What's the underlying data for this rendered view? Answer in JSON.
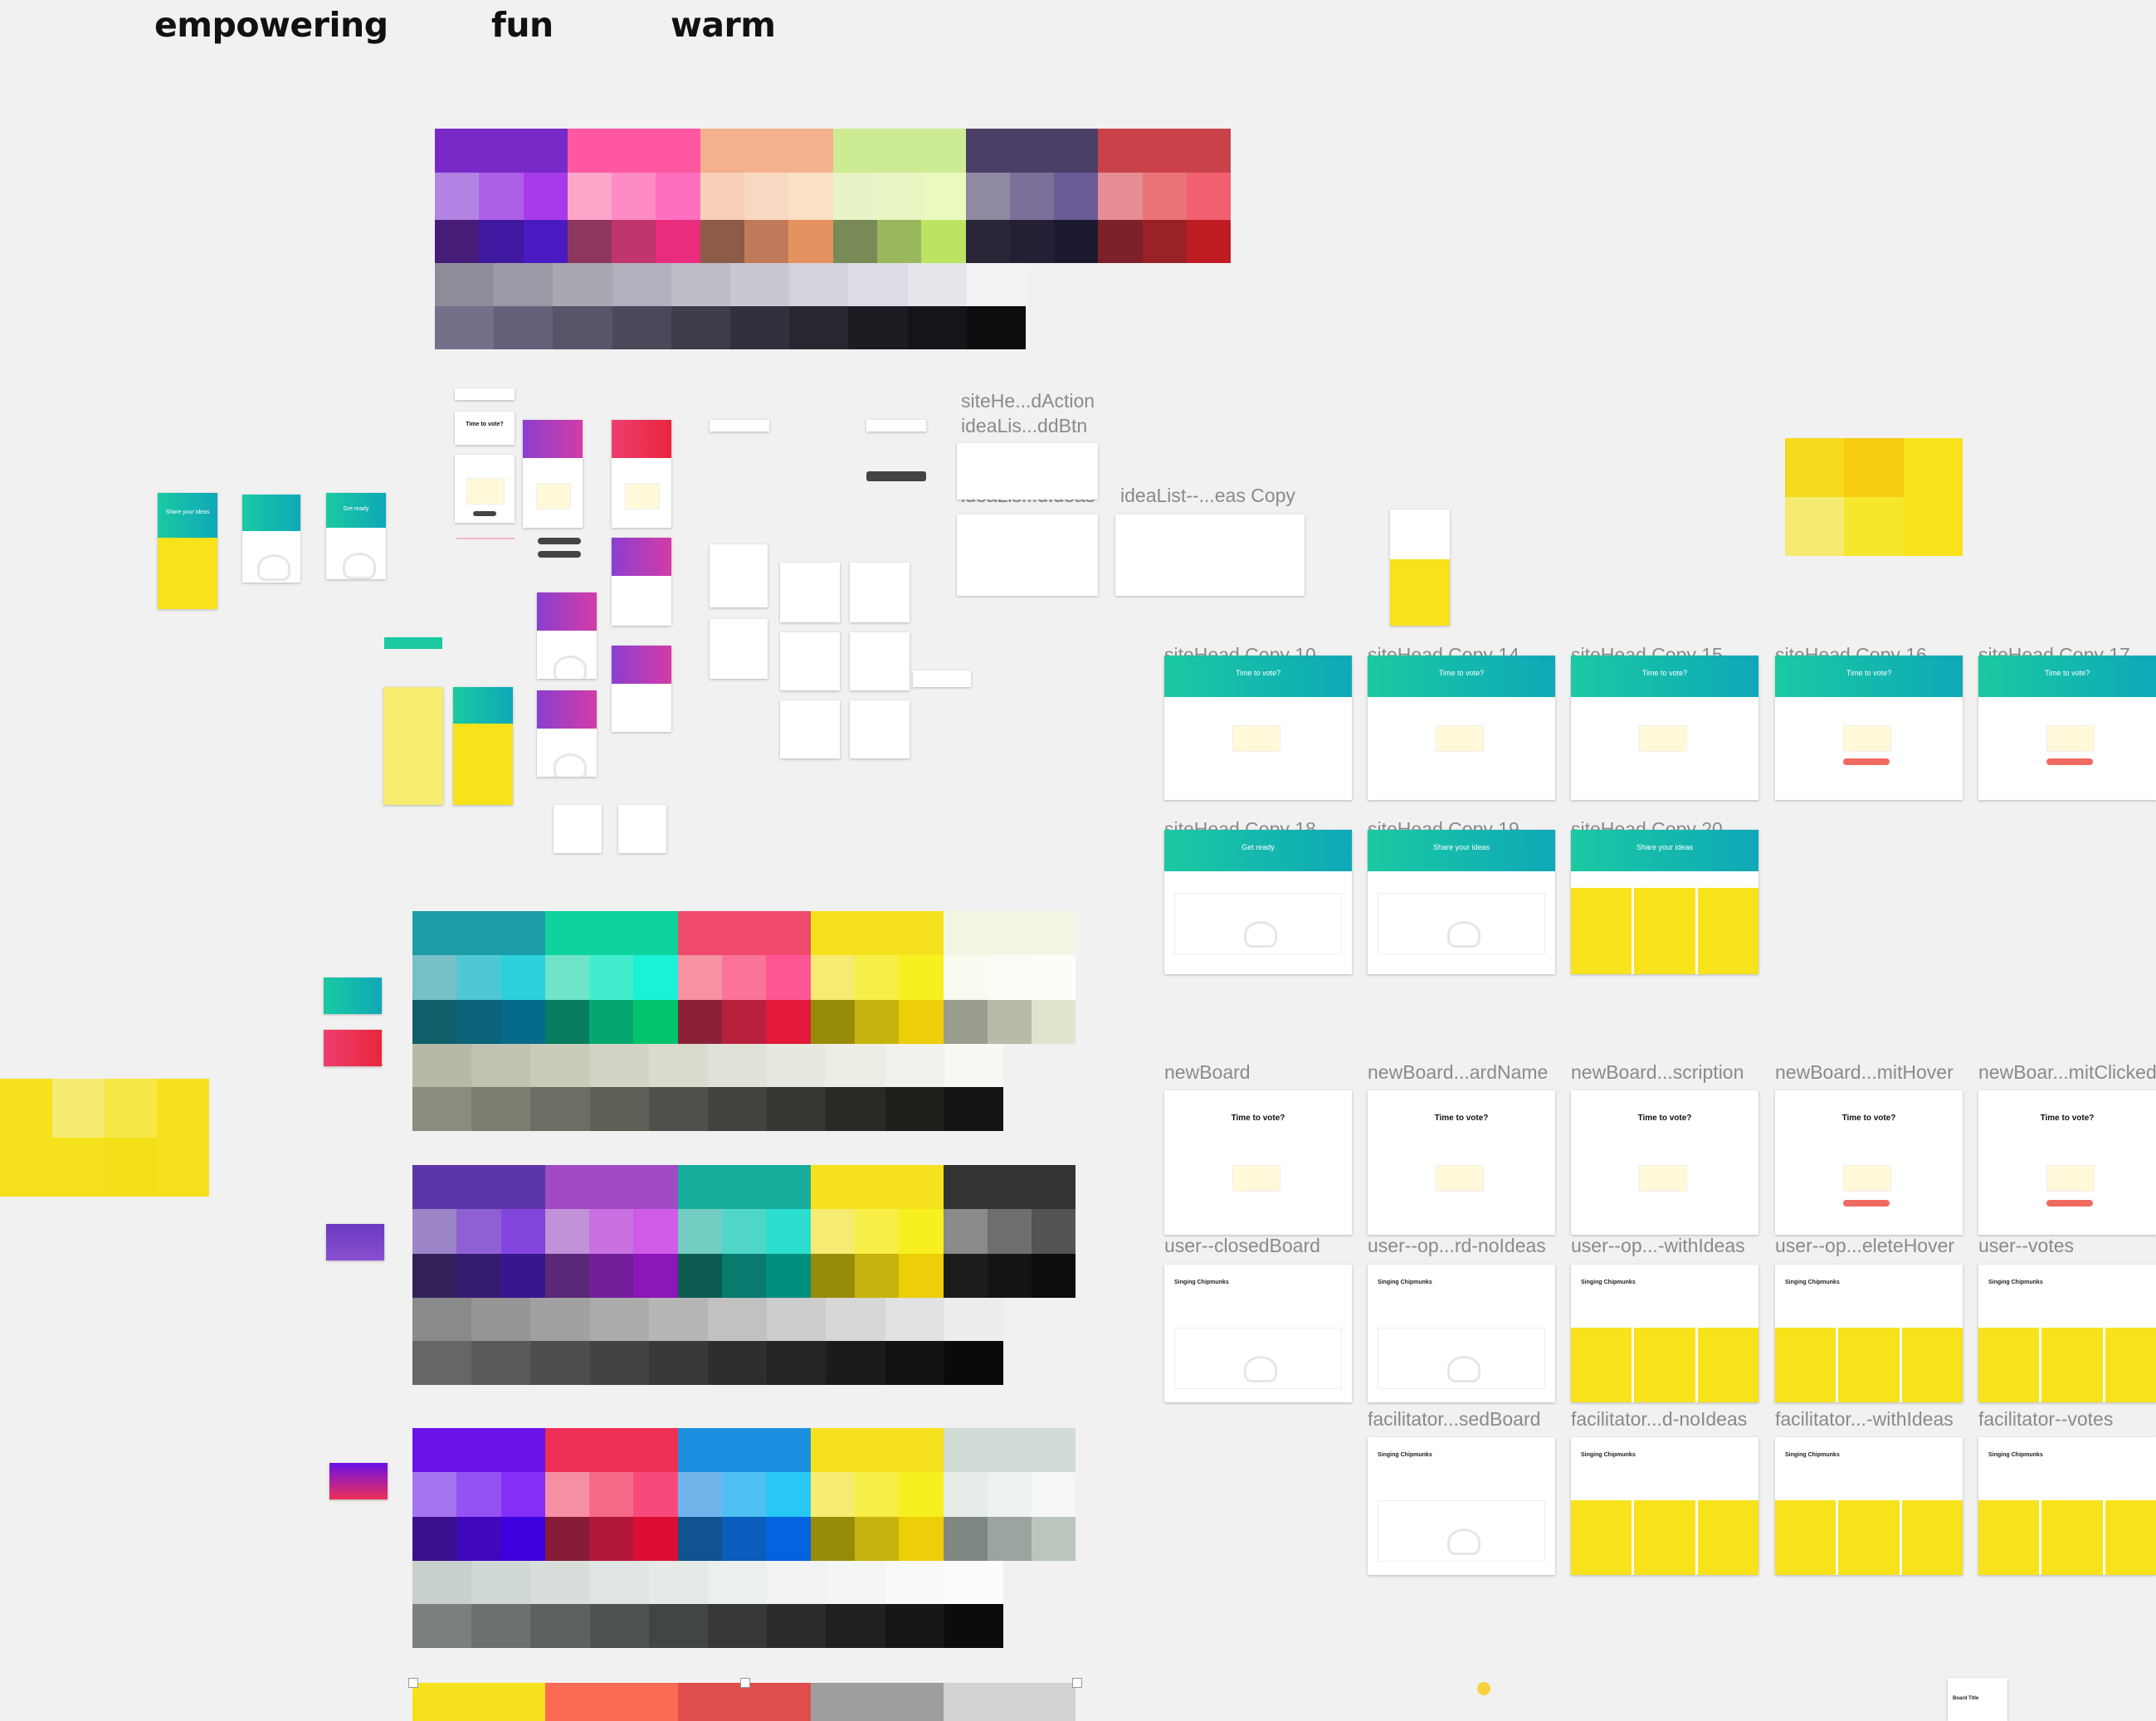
{
  "moods": [
    "empowering",
    "fun",
    "warm"
  ],
  "palettes": [
    {
      "name": "palette-primary",
      "rows": [
        [
          "#7a29c9",
          "#7a29c9",
          "#7a29c9",
          "#ff58a1",
          "#ff58a1",
          "#ff58a1",
          "#f5b08d",
          "#f5b08d",
          "#f5b08d",
          "#cdeb92",
          "#cdeb92",
          "#cdeb92",
          "#4b3f67",
          "#4b3f67",
          "#4b3f67",
          "#c9424a",
          "#c9424a",
          "#c9424a"
        ],
        [
          "#b383e3",
          "#ad5fe7",
          "#a83be9",
          "#fca7ca",
          "#fd8cc5",
          "#fd6fbe",
          "#f8cfb8",
          "#f9d8c3",
          "#fbdfc6",
          "#e8f4c7",
          "#e9f6c4",
          "#e9f9bf",
          "#8f8aa1",
          "#7c6f9a",
          "#6b5c97",
          "#e68c93",
          "#e97376",
          "#f06070"
        ],
        [
          "#451c77",
          "#3f18a1",
          "#4b19c1",
          "#8e375e",
          "#c0356c",
          "#ea2c7c",
          "#8c5c47",
          "#c07a59",
          "#e69260",
          "#788a55",
          "#9ab75e",
          "#bde362",
          "#2a2637",
          "#231f35",
          "#1c1a30",
          "#7c202a",
          "#982228",
          "#bd1c22"
        ],
        [
          "#8e8c99",
          "#9c9aa6",
          "#a9a7b2",
          "#b2b0bc",
          "#bebcc6",
          "#c9c7d1",
          "#d4d3dc",
          "#dddce4",
          "#e6e6ec",
          "#f2f2f4"
        ],
        [
          "#74708a",
          "#66617a",
          "#595469",
          "#4c4759",
          "#3f3b4a",
          "#33303d",
          "#28262f",
          "#1e1c23",
          "#151419",
          "#0d0c0f"
        ]
      ]
    },
    {
      "name": "palette-teal",
      "rows": [
        [
          "#1c9ba8",
          "#1c9ba8",
          "#1c9ba8",
          "#0fd39e",
          "#0fd39e",
          "#0fd39e",
          "#ef4a6c",
          "#ef4a6c",
          "#ef4a6c",
          "#f6e21c",
          "#f6e21c",
          "#f6e21c",
          "#f4f6e5",
          "#f4f6e5",
          "#f4f6e5"
        ],
        [
          "#76c0c8",
          "#4fc8d3",
          "#2bd0dc",
          "#6ee5c8",
          "#41edcd",
          "#1af1d5",
          "#f792a3",
          "#fa7398",
          "#fd5593",
          "#f6ec72",
          "#f7ee48",
          "#f8ef1f",
          "#f9faf0",
          "#fbfcf5",
          "#fcfdf8"
        ],
        [
          "#0f5f6b",
          "#0a6378",
          "#066b8b",
          "#087c5e",
          "#04a76f",
          "#02c46c",
          "#8a2139",
          "#b8203d",
          "#e3183a",
          "#978b0a",
          "#c6b30e",
          "#eccf08",
          "#9a9d8e",
          "#b8bba8",
          "#e1e4cd"
        ],
        [
          "#b7b8a7",
          "#c1c2b2",
          "#cacbbb",
          "#d2d3c4",
          "#dadbce",
          "#e1e2d7",
          "#e7e8df",
          "#edede6",
          "#f2f2ed",
          "#f7f7f3"
        ],
        [
          "#8b8c80",
          "#7c7d71",
          "#6d6e63",
          "#5e5f56",
          "#4f5049",
          "#42433d",
          "#353631",
          "#292a26",
          "#1e1e1b",
          "#131311"
        ]
      ]
    },
    {
      "name": "palette-purple",
      "rows": [
        [
          "#5c35a8",
          "#5c35a8",
          "#5c35a8",
          "#a04ac6",
          "#a04ac6",
          "#a04ac6",
          "#16ad9a",
          "#16ad9a",
          "#16ad9a",
          "#f6e21c",
          "#f6e21c",
          "#f6e21c",
          "#333333",
          "#333333",
          "#333333"
        ],
        [
          "#9d85c9",
          "#8f60d4",
          "#8145de",
          "#c292d8",
          "#c971e0",
          "#d05be6",
          "#73ccc1",
          "#50d6c8",
          "#2bded0",
          "#f6ec72",
          "#f7ee48",
          "#f8ef1f",
          "#8a8a8a",
          "#6f6f6f",
          "#545454"
        ],
        [
          "#33215a",
          "#351c73",
          "#38168d",
          "#5b2777",
          "#721e9a",
          "#8b17b8",
          "#0d5c52",
          "#087a6e",
          "#018f80",
          "#978b0a",
          "#c6b30e",
          "#eccf08",
          "#1c1c1c",
          "#141414",
          "#0d0d0d"
        ],
        [
          "#8a8a8a",
          "#959595",
          "#a0a0a0",
          "#ababab",
          "#b6b6b6",
          "#c1c1c1",
          "#cccccc",
          "#d7d7d7",
          "#e2e2e2",
          "#ededed"
        ],
        [
          "#666666",
          "#5a5a5a",
          "#4e4e4e",
          "#434343",
          "#383838",
          "#2e2e2e",
          "#242424",
          "#1b1b1b",
          "#121212",
          "#0a0a0a"
        ]
      ]
    },
    {
      "name": "palette-violet",
      "rows": [
        [
          "#6a12e8",
          "#6a12e8",
          "#6a12e8",
          "#ef2e55",
          "#ef2e55",
          "#ef2e55",
          "#1d8fe0",
          "#1d8fe0",
          "#1d8fe0",
          "#f6e21c",
          "#f6e21c",
          "#f6e21c",
          "#d2dcd6",
          "#d2dcd6",
          "#d2dcd6"
        ],
        [
          "#a574f0",
          "#9451f3",
          "#8530f7",
          "#f58fa3",
          "#f76989",
          "#f84a7a",
          "#72b5ec",
          "#4ec0f2",
          "#28c8f6",
          "#f6ec72",
          "#f7ee48",
          "#f8ef1f",
          "#e6ece8",
          "#eef2f0",
          "#f5f7f6"
        ],
        [
          "#3c0f8e",
          "#3f08ba",
          "#3f00e0",
          "#861c35",
          "#b1163b",
          "#dc0e34",
          "#0f5390",
          "#0a5dbc",
          "#0464e0",
          "#978b0a",
          "#c6b30e",
          "#eccf08",
          "#7f8782",
          "#9ca49f",
          "#bac5be"
        ],
        [
          "#c7d0cb",
          "#d0d8d3",
          "#d8dfdb",
          "#dfe5e2",
          "#e5eae7",
          "#ebefed",
          "#f0f3f1",
          "#f4f6f5",
          "#f8f9f8",
          "#fbfcfb"
        ],
        [
          "#7a807c",
          "#6b716d",
          "#5c625f",
          "#4e5350",
          "#414543",
          "#353836",
          "#2a2c2b",
          "#1f2120",
          "#151616",
          "#0b0c0b"
        ]
      ]
    },
    {
      "name": "palette-bottom",
      "rows": [
        [
          "#f6e21c",
          "#f6e21c",
          "#f6e21c",
          "#fd6a55",
          "#fd6a55",
          "#fd6a55",
          "#dd4e4c",
          "#dd4e4c",
          "#dd4e4c",
          "#9e9e9e",
          "#9e9e9e",
          "#9e9e9e",
          "#d2d2d2",
          "#d2d2d2",
          "#d2d2d2"
        ]
      ]
    }
  ],
  "yellow_swatches": {
    "right": [
      "#f7d91d",
      "#f6cd12",
      "#f7e21c",
      "#f5ea72",
      "#f6e62c",
      "#f7e21c"
    ],
    "left": [
      "#f6e21c",
      "#f5ea72",
      "#f7e747",
      "#f6e21c",
      "#f6e21c",
      "#f6e21c",
      "#f4df18",
      "#f6e21c"
    ]
  },
  "labels": {
    "row1": [
      "siteHead Copy 10",
      "siteHead Copy 14",
      "siteHead Copy 15",
      "siteHead Copy 16",
      "siteHead Copy 17"
    ],
    "row2": [
      "siteHead Copy 18",
      "siteHead Copy 19",
      "siteHead Copy 20"
    ],
    "row3": [
      "newBoard",
      "newBoard...ardName",
      "newBoard...scription",
      "newBoard...mitHover",
      "newBoar...mitClicked"
    ],
    "row4": [
      "user--closedBoard",
      "user--op...rd-noIdeas",
      "user--op...-withIdeas",
      "user--op...eleteHover",
      "user--votes"
    ],
    "row5": [
      "facilitator...sedBoard",
      "facilitator...d-noIdeas",
      "facilitator...-withIdeas",
      "facilitator--votes"
    ],
    "components": [
      "siteHe...dAction",
      "ideaLis...ddBtn",
      "ideaLis...dIdeas",
      "ideaList--...eas Copy"
    ]
  },
  "frame_text": {
    "time_to_vote": "Time to vote?",
    "get_ready": "Get ready",
    "share_ideas": "Share your ideas",
    "board_name": "Singing Chipmunks",
    "board_title": "Board Title"
  }
}
